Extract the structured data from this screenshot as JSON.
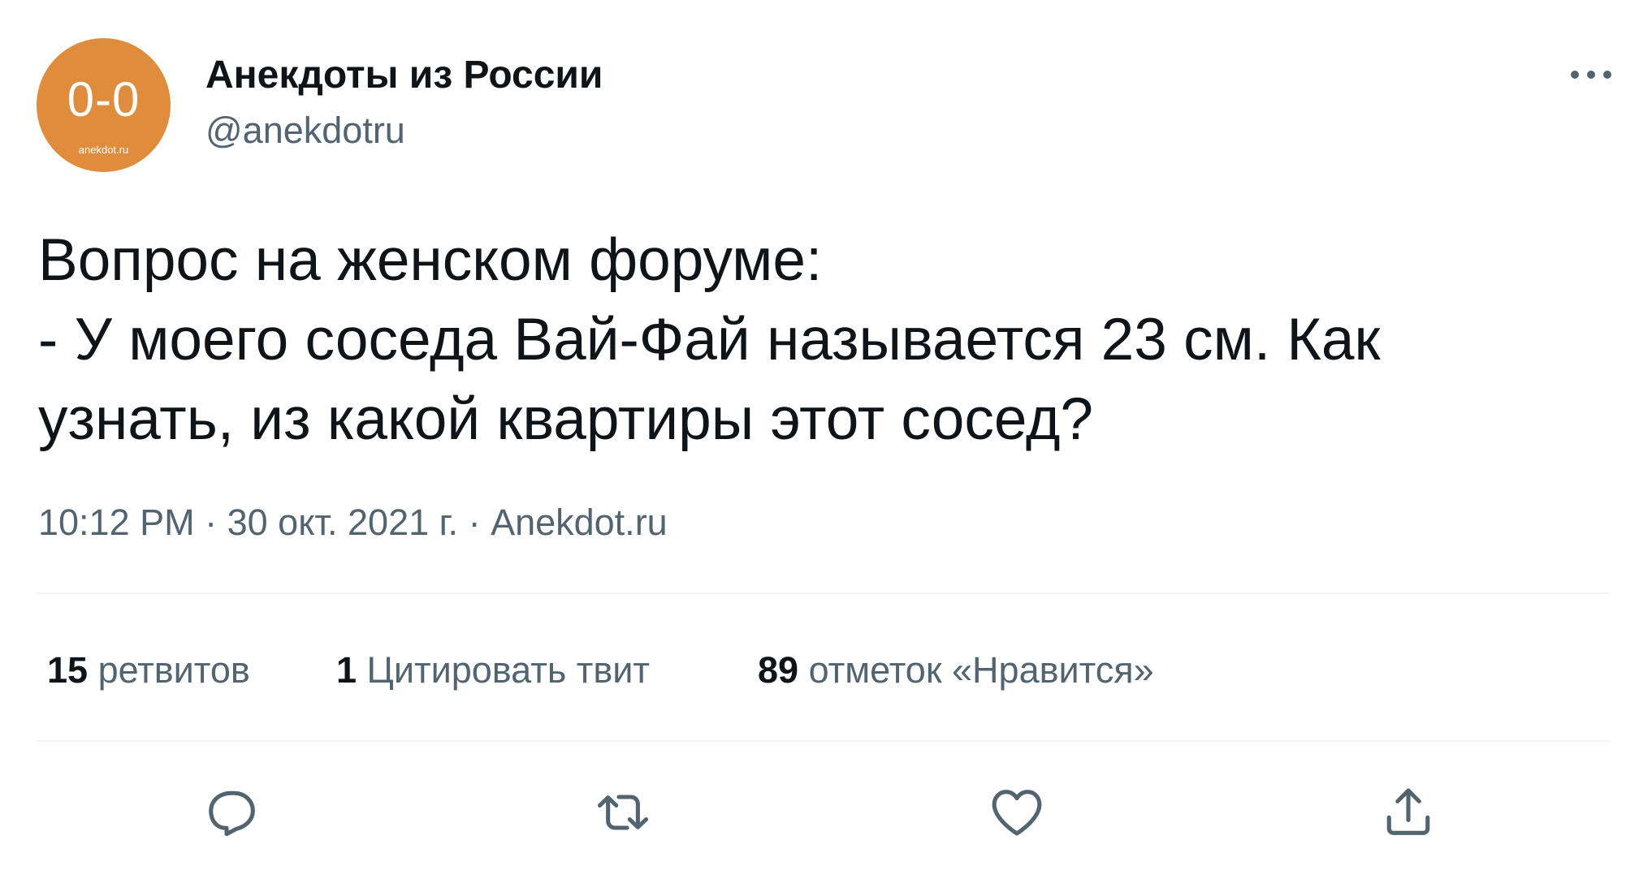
{
  "author": {
    "avatar_text": "0-0",
    "avatar_subtext": "anekdot.ru",
    "display_name": "Анекдоты из России",
    "handle": "@anekdotru"
  },
  "tweet": {
    "lines": [
      "Вопрос на женском форуме:",
      "- У моего соседа Вай-Фай называется 23 см. Как",
      "узнать, из какой квартиры этот сосед?"
    ]
  },
  "meta": {
    "time": "10:12 PM",
    "separator": " · ",
    "date": "30 окт. 2021 г.",
    "source": "Anekdot.ru"
  },
  "stats": {
    "retweets": {
      "count": "15",
      "label": "ретвитов"
    },
    "quotes": {
      "count": "1",
      "label": "Цитировать твит"
    },
    "likes": {
      "count": "89",
      "label": "отметок «Нравится»"
    }
  },
  "icons": {
    "more": "more-horizontal-icon",
    "reply": "reply-icon",
    "retweet": "retweet-icon",
    "like": "heart-icon",
    "share": "share-icon"
  },
  "colors": {
    "avatar_bg": "#df8d3d",
    "text_primary": "#0f1419",
    "text_secondary": "#536471",
    "divider": "#eff3f4"
  }
}
